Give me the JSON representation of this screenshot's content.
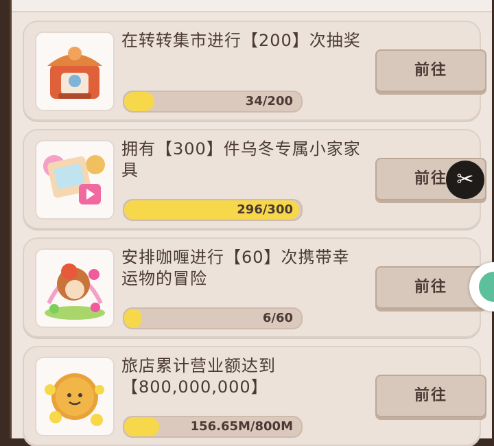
{
  "tasks": [
    {
      "title": "在转转集市进行【200】次抽奖",
      "progress_text": "34/200",
      "progress": 0.17,
      "button": "前往",
      "icon": "carousel-stage-icon"
    },
    {
      "title": "拥有【300】件乌冬专属小家家具",
      "progress_text": "296/300",
      "progress": 0.987,
      "button": "前往",
      "icon": "furniture-set-icon"
    },
    {
      "title": "安排咖喱进行【60】次携带幸运物的冒险",
      "progress_text": "6/60",
      "progress": 0.1,
      "button": "前往",
      "icon": "curry-adventure-icon"
    },
    {
      "title": "旅店累计营业额达到【800,000,000】",
      "progress_text": "156.65M/800M",
      "progress": 0.196,
      "button": "前往",
      "icon": "gold-cookie-icon"
    }
  ],
  "overlay": {
    "scissors_icon": "scissors-icon",
    "side_icon": "assistant-bubble-icon"
  },
  "colors": {
    "progress_fill": "#f7d84a",
    "card_bg": "#ece2da",
    "button_bg": "#d8c7bb"
  }
}
